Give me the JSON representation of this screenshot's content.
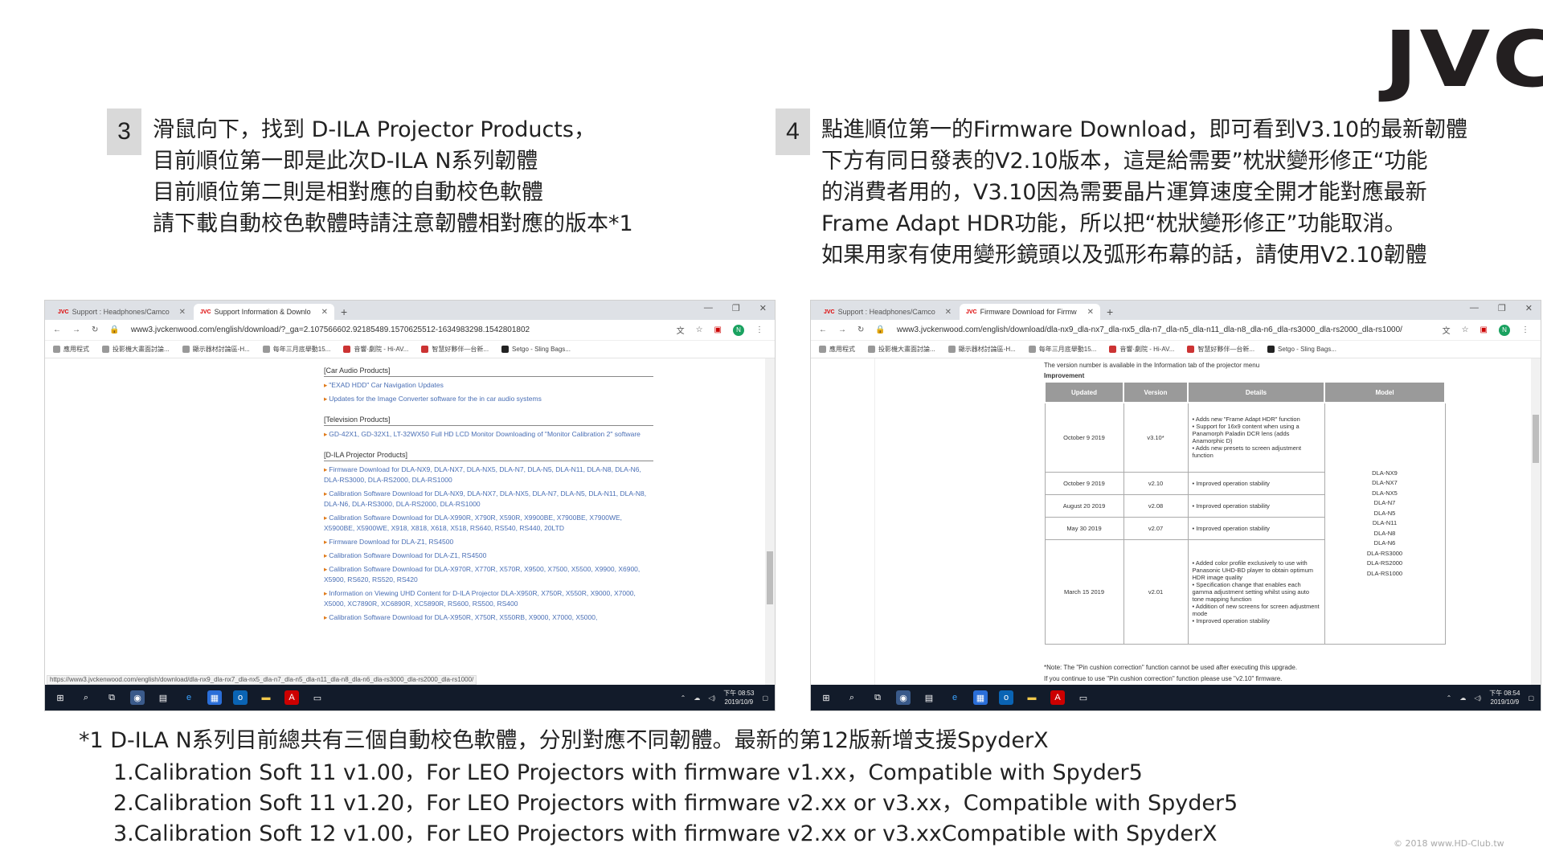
{
  "logo": "JVC",
  "step3": {
    "number": "3",
    "lines": [
      "滑鼠向下，找到 D-ILA Projector Products，",
      "目前順位第一即是此次D-ILA N系列韌體",
      "目前順位第二則是相對應的自動校色軟體",
      "請下載自動校色軟體時請注意韌體相對應的版本*1"
    ]
  },
  "step4": {
    "number": "4",
    "lines": [
      "點進順位第一的Firmware Download，即可看到V3.10的最新韌體",
      "下方有同日發表的V2.10版本，這是給需要”枕狀變形修正“功能",
      "的消費者用的，V3.10因為需要晶片運算速度全開才能對應最新",
      "Frame Adapt HDR功能，所以把“枕狀變形修正”功能取消。",
      "如果用家有使用變形鏡頭以及弧形布幕的話，請使用V2.10韌體"
    ]
  },
  "browser_left": {
    "tabs": [
      {
        "label": "Support : Headphones/Camco",
        "active": false
      },
      {
        "label": "Support Information & Downlo",
        "active": true
      }
    ],
    "url": "www3.jvckenwood.com/english/download/?_ga=2.107566602.92185489.1570625512-1634983298.1542801802",
    "bookmarks": [
      "應用程式",
      "投影機大畫面討論...",
      "顯示器材討論區-H...",
      "每年三月底舉動15...",
      "音響·劇院 - Hi-AV...",
      "智慧好夥伴—台新...",
      "Setgo - Sling Bags..."
    ],
    "sections": [
      {
        "title": "[Car Audio Products]",
        "items": [
          "\"EXAD HDD\" Car Navigation Updates",
          "Updates for the Image Converter software for the in car audio systems"
        ]
      },
      {
        "title": "[Television Products]",
        "items": [
          "GD-42X1, GD-32X1, LT-32WX50 Full HD LCD Monitor Downloading of \"Monitor Calibration 2\" software"
        ]
      },
      {
        "title": "[D-ILA Projector Products]",
        "items": [
          "Firmware Download for DLA-NX9, DLA-NX7, DLA-NX5, DLA-N7, DLA-N5, DLA-N11, DLA-N8, DLA-N6, DLA-RS3000, DLA-RS2000, DLA-RS1000",
          "Calibration Software Download for DLA-NX9, DLA-NX7, DLA-NX5, DLA-N7, DLA-N5, DLA-N11, DLA-N8, DLA-N6, DLA-RS3000, DLA-RS2000, DLA-RS1000",
          "Calibration Software Download for DLA-X990R, X790R, X590R, X9900BE, X7900BE, X7900WE, X5900BE, X5900WE, X918, X818, X618, X518, RS640, RS540, RS440, 20LTD",
          "Firmware Download for DLA-Z1, RS4500",
          "Calibration Software Download for DLA-Z1, RS4500",
          "Calibration Software Download for DLA-X970R, X770R, X570R, X9500, X7500, X5500, X9900, X6900, X5900, RS620, RS520, RS420",
          "Information on Viewing UHD Content for D-ILA Projector DLA-X950R, X750R, X550R, X9000, X7000, X5000, XC7890R, XC6890R, XC5890R, RS600, RS500, RS400",
          "Calibration Software Download for DLA-X950R, X750R, X550RB, X9000, X7000, X5000,"
        ]
      }
    ],
    "status_url": "https://www3.jvckenwood.com/english/download/dla-nx9_dla-nx7_dla-nx5_dla-n7_dla-n5_dla-n11_dla-n8_dla-n6_dla-rs3000_dla-rs2000_dla-rs1000/",
    "clock": {
      "time": "下午 08:53",
      "date": "2019/10/9"
    }
  },
  "browser_right": {
    "tabs": [
      {
        "label": "Support : Headphones/Camco",
        "active": false
      },
      {
        "label": "Firmware Download for Firmw",
        "active": true
      }
    ],
    "url": "www3.jvckenwood.com/english/download/dla-nx9_dla-nx7_dla-nx5_dla-n7_dla-n5_dla-n11_dla-n8_dla-n6_dla-rs3000_dla-rs2000_dla-rs1000/",
    "bookmarks": [
      "應用程式",
      "投影機大畫面討論...",
      "顯示器材討論區-H...",
      "每年三月底舉動15...",
      "音響·劇院 - Hi-AV...",
      "智慧好夥伴—台新...",
      "Setgo - Sling Bags..."
    ],
    "intro": "The version number is available in the Information tab of the projector menu",
    "improvement_label": "Improvement",
    "table": {
      "headers": [
        "Updated",
        "Version",
        "Details",
        "Model"
      ],
      "rows": [
        {
          "updated": "October 9 2019",
          "version": "v3.10*",
          "details": [
            "Adds new \"Frame Adapt HDR\" function",
            "Support for 16x9 content when using a Panamorph Paladin DCR lens (adds Anamorphic D)",
            "Adds new presets to screen adjustment function"
          ]
        },
        {
          "updated": "October 9 2019",
          "version": "v2.10",
          "details": [
            "Improved operation stability"
          ]
        },
        {
          "updated": "August 20 2019",
          "version": "v2.08",
          "details": [
            "Improved operation stability"
          ]
        },
        {
          "updated": "May 30 2019",
          "version": "v2.07",
          "details": [
            "Improved operation stability"
          ]
        },
        {
          "updated": "March 15 2019",
          "version": "v2.01",
          "details": [
            "Added color profile exclusively to use with Panasonic UHD-BD player to obtain optimum HDR image quality",
            "Specification change that enables each gamma adjustment setting whilst using auto tone mapping function",
            "Addition of new screens for screen adjustment mode",
            "Improved operation stability"
          ]
        }
      ],
      "models": [
        "DLA-NX9",
        "DLA-NX7",
        "DLA-NX5",
        "DLA-N7",
        "DLA-N5",
        "DLA-N11",
        "DLA-N8",
        "DLA-N6",
        "DLA-RS3000",
        "DLA-RS2000",
        "DLA-RS1000"
      ]
    },
    "notes": [
      "*Note: The \"Pin cushion correction\" function cannot be used after executing this upgrade.",
      "If you continue to use \"Pin cushion correction\" function please use \"v2.10\" firmware."
    ],
    "clock": {
      "time": "下午 08:54",
      "date": "2019/10/9"
    }
  },
  "footnote": {
    "title": "*1 D-ILA N系列目前總共有三個自動校色軟體，分別對應不同韌體。最新的第12版新增支援SpyderX",
    "items": [
      "1.Calibration Soft 11 v1.00，For LEO Projectors with firmware v1.xx，Compatible with Spyder5",
      "2.Calibration Soft 11 v1.20，For LEO Projectors with firmware v2.xx or v3.xx，Compatible with Spyder5",
      "3.Calibration Soft 12 v1.00，For LEO Projectors with firmware v2.xx or v3.xxCompatible with SpyderX"
    ]
  },
  "watermark": "© 2018 www.HD-Club.tw"
}
